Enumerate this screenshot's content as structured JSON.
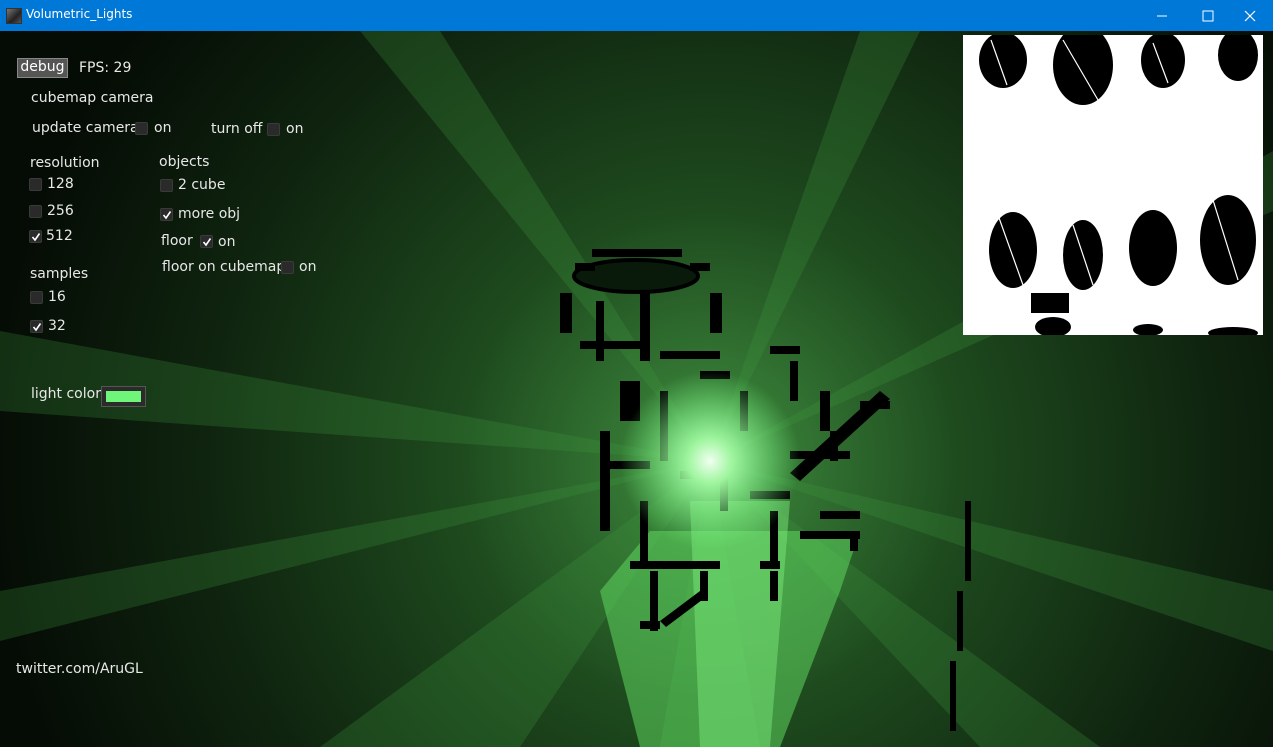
{
  "window": {
    "title": "Volumetric_Lights"
  },
  "debug_button": "debug",
  "fps": "FPS: 29",
  "cubemap": {
    "heading": "cubemap camera",
    "update_camera": {
      "label": "update camera",
      "option": "on",
      "checked": false
    },
    "turn_off": {
      "label": "turn off",
      "option": "on",
      "checked": false
    }
  },
  "resolution": {
    "heading": "resolution",
    "options": [
      {
        "label": "128",
        "checked": false
      },
      {
        "label": "256",
        "checked": false
      },
      {
        "label": "512",
        "checked": true
      }
    ]
  },
  "samples": {
    "heading": "samples",
    "options": [
      {
        "label": "16",
        "checked": false
      },
      {
        "label": "32",
        "checked": true
      }
    ]
  },
  "objects": {
    "heading": "objects",
    "two_cube": {
      "label": "2 cube",
      "checked": false
    },
    "more_obj": {
      "label": "more obj",
      "checked": true
    },
    "floor": {
      "label": "floor",
      "option": "on",
      "checked": true
    },
    "floor_on_cubemap": {
      "label": "floor on cubemap",
      "option": "on",
      "checked": false
    }
  },
  "light_color": {
    "label": "light color",
    "value": "#6ef57a"
  },
  "credit": "twitter.com/AruGL",
  "colors": {
    "titlebar": "#0078d7",
    "scene_bg": "#0c1a0c",
    "light": "#6ef57a"
  }
}
